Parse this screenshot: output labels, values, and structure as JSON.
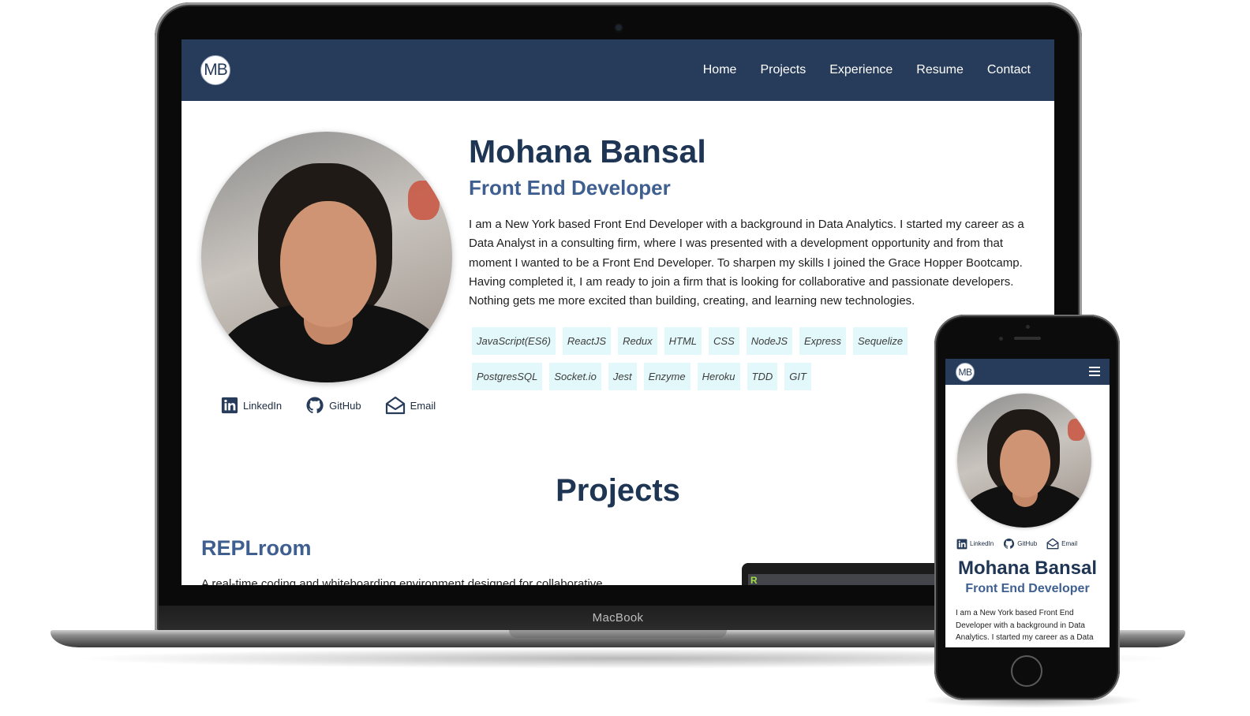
{
  "device_labels": {
    "laptop": "MacBook"
  },
  "site": {
    "logo": "MB",
    "nav": [
      "Home",
      "Projects",
      "Experience",
      "Resume",
      "Contact"
    ],
    "name": "Mohana Bansal",
    "role": "Front End Developer",
    "bio": "I am a New York based Front End Developer with a background in Data Analytics. I started my career as a Data Analyst in a consulting firm, where I was presented with a development opportunity and from that moment I wanted to be a Front End Developer. To sharpen my skills I joined the Grace Hopper Bootcamp. Having completed it, I am ready to join a firm that is looking for collaborative and passionate developers. Nothing gets me more excited than building, creating, and learning new technologies.",
    "skills": [
      "JavaScript(ES6)",
      "ReactJS",
      "Redux",
      "HTML",
      "CSS",
      "NodeJS",
      "Express",
      "Sequelize",
      "PostgresSQL",
      "Socket.io",
      "Jest",
      "Enzyme",
      "Heroku",
      "TDD",
      "GIT"
    ],
    "social": {
      "linkedin": "LinkedIn",
      "github": "GitHub",
      "email": "Email"
    },
    "projects_heading": "Projects",
    "project": {
      "title": "REPLroom",
      "description_partial": "A real-time coding and whiteboarding environment designed for collaborative",
      "thumbnail_letter": "R"
    }
  },
  "phone": {
    "logo": "MB",
    "menu_icon": "hamburger-menu-icon",
    "social": {
      "linkedin": "LinkedIn",
      "github": "GitHub",
      "email": "Email"
    },
    "name": "Mohana Bansal",
    "role": "Front End Developer",
    "bio_partial": "I am a New York based Front End Developer with a background in Data Analytics. I started my career as a Data"
  },
  "colors": {
    "nav": "#273c5a",
    "heading": "#1e3554",
    "subheading": "#3e5f8f",
    "skill_bg": "#e3f8fa"
  }
}
